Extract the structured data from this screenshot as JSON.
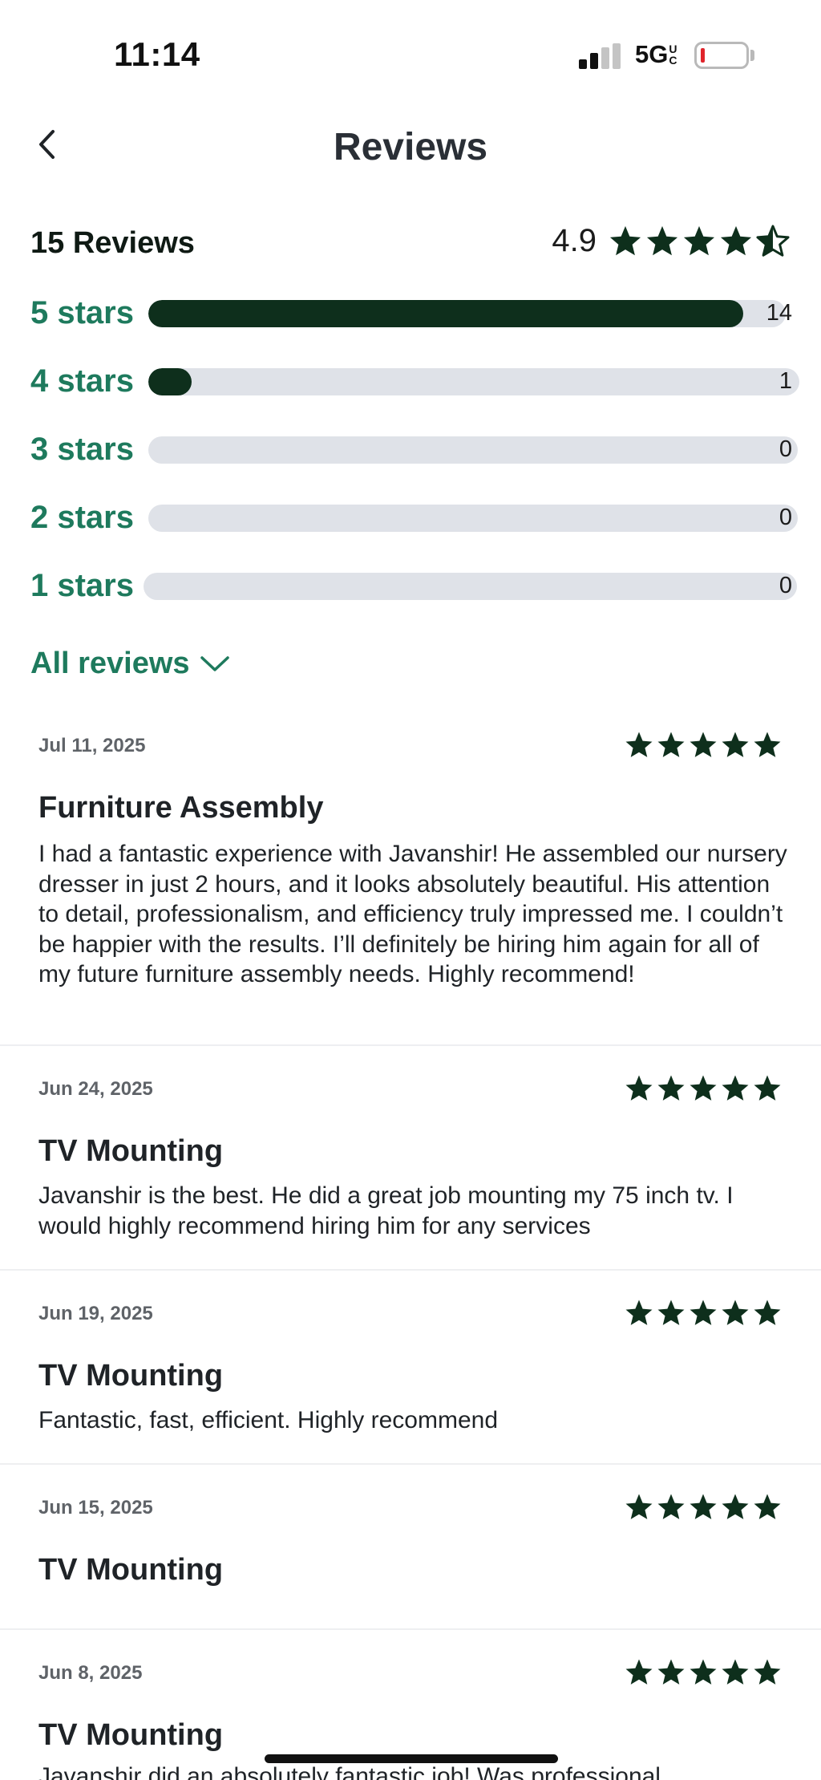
{
  "status_bar": {
    "time": "11:14",
    "network": "5G",
    "network_suffix": "UC"
  },
  "header": {
    "title": "Reviews",
    "back_icon": "chevron-left-icon"
  },
  "summary": {
    "count_label": "15 Reviews",
    "average": "4.9",
    "average_value": 4.9,
    "breakdown": [
      {
        "label": "5 stars",
        "count": "14",
        "value": 14
      },
      {
        "label": "4 stars",
        "count": "1",
        "value": 1
      },
      {
        "label": "3 stars",
        "count": "0",
        "value": 0
      },
      {
        "label": "2 stars",
        "count": "0",
        "value": 0
      },
      {
        "label": "1 stars",
        "count": "0",
        "value": 0
      }
    ],
    "total": 15
  },
  "filter": {
    "label": "All reviews",
    "icon": "chevron-down-icon"
  },
  "reviews": [
    {
      "date": "Jul 11, 2025",
      "rating": 5,
      "service": "Furniture Assembly",
      "text": "I had a fantastic experience with Javanshir! He assembled our nursery dresser in just 2 hours, and it looks absolutely beautiful. His attention to detail, professionalism, and efficiency truly impressed me. I couldn’t be happier with the results. I’ll definitely be hiring him again for all of my future furniture assembly needs. Highly recommend!"
    },
    {
      "date": "Jun 24, 2025",
      "rating": 5,
      "service": "TV Mounting",
      "text": "Javanshir is the best. He did a great job mounting my 75 inch tv. I would highly recommend hiring him for any services"
    },
    {
      "date": "Jun 19, 2025",
      "rating": 5,
      "service": "TV Mounting",
      "text": "Fantastic, fast, efficient. Highly recommend"
    },
    {
      "date": "Jun 15, 2025",
      "rating": 5,
      "service": "TV Mounting",
      "text": ""
    },
    {
      "date": "Jun 8, 2025",
      "rating": 5,
      "service": "TV Mounting",
      "text": "Javanshir did an absolutely fantastic job! Was professional"
    }
  ],
  "colors": {
    "accent_green": "#1e7a5d",
    "star_dark_green": "#0e2f1c",
    "bar_track": "#dfe2e8",
    "battery_low": "#e0242b"
  }
}
